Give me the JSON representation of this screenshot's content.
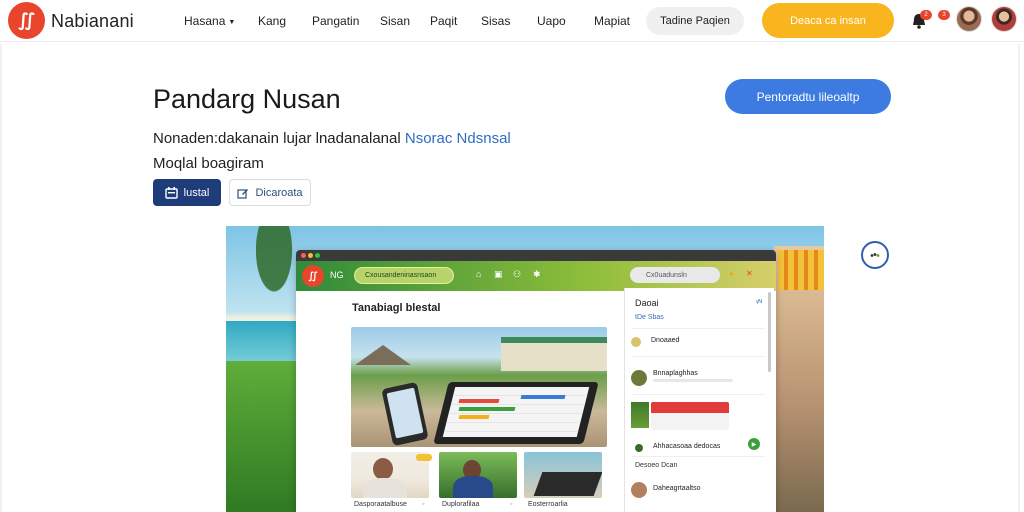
{
  "nav": {
    "logo_glyph": "∬",
    "logo_name": "Nabianani",
    "links": [
      {
        "label": "Hasana",
        "has_caret": true
      },
      {
        "label": "Kang"
      },
      {
        "label": "Pangatin"
      },
      {
        "label": "Sisan"
      },
      {
        "label": "Paqit"
      },
      {
        "label": "Sisas"
      },
      {
        "label": "Uapo"
      },
      {
        "label": "Mapiat"
      }
    ],
    "pill_label": "Tadine Paqien",
    "cta_label": "Deaca ca insan",
    "badges": [
      "2",
      "3"
    ]
  },
  "hero": {
    "title": "Pandarg Nusan",
    "desc_main": "Nonaden:dakanain lujar lnadanalanal",
    "desc_link": "Nsorac Ndsnsal",
    "desc_line2": "Moqlal boagiram",
    "cta_label": "Pentoradtu lileoaltp",
    "btn_primary_label": "lustal",
    "btn_secondary_label": "Dicaroata"
  },
  "showcase": {
    "window": {
      "toolbar_text": "NG",
      "search_text": "Cxousandeninasnsaon",
      "search2_text": "Cx0uadunsln",
      "main_heading": "Tanabiagl blestal",
      "captions": [
        "Dasporaatalbuse",
        "Duplorafilaa",
        "Eosterroarlia"
      ]
    },
    "panel": {
      "title": "Daoai",
      "subtitle": "tDe Sbas",
      "right_icon": "ᵞᴺ",
      "rows": [
        {
          "name": "Dnoaaed",
          "color": "#d8c26a"
        },
        {
          "name": "Bnnaplaghhas",
          "color": "#6b7a3a"
        },
        {
          "name": "Ahhacasoaa dedocas",
          "color": "#3a6a2a"
        },
        {
          "name": "Ahhacasoaa dedocas",
          "color": "#b08060"
        }
      ],
      "section_label": "Desoeo Dcan",
      "section_row": "Daheagrtaaltso"
    }
  }
}
